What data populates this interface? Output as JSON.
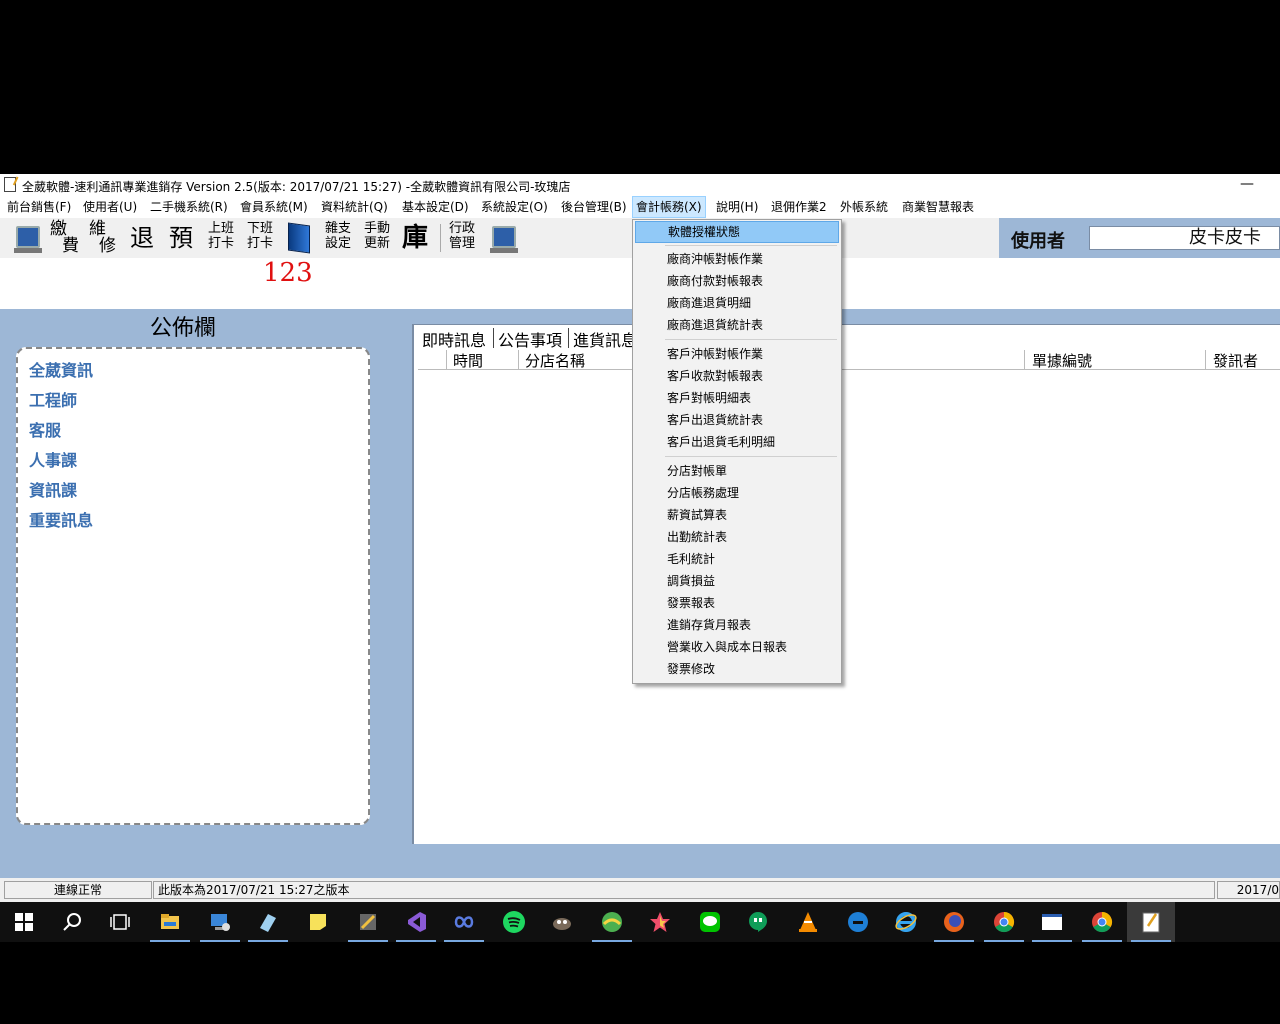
{
  "window": {
    "title": "全葳軟體-速利通訊專業進銷存 Version 2.5(版本: 2017/07/21 15:27) -全葳軟體資訊有限公司-玫瑰店",
    "minimize_glyph": "—"
  },
  "menubar": {
    "items": [
      {
        "label": "前台銷售(F)"
      },
      {
        "label": "使用者(U)"
      },
      {
        "label": "二手機系統(R)"
      },
      {
        "label": "會員系統(M)"
      },
      {
        "label": "資料統計(Q)"
      },
      {
        "label": "基本設定(D)"
      },
      {
        "label": "系統設定(O)"
      },
      {
        "label": "後台管理(B)"
      },
      {
        "label": "會計帳務(X)",
        "active": true
      },
      {
        "label": "說明(H)"
      },
      {
        "label": "退佣作業2"
      },
      {
        "label": "外帳系統"
      },
      {
        "label": "商業智慧報表"
      }
    ]
  },
  "toolbar": {
    "buttons": [
      {
        "name": "computer-icon",
        "type": "icon"
      },
      {
        "name": "pay",
        "line1": "繳",
        "line2": "費"
      },
      {
        "name": "repair",
        "line1": "維",
        "line2": "修"
      },
      {
        "name": "return",
        "text": "退"
      },
      {
        "name": "reserve",
        "text": "預"
      },
      {
        "name": "clock-in",
        "line1": "上班",
        "line2": "打卡"
      },
      {
        "name": "clock-out",
        "line1": "下班",
        "line2": "打卡"
      },
      {
        "name": "book-icon",
        "type": "icon"
      },
      {
        "name": "misc-expense",
        "line1": "雜支",
        "line2": "設定"
      },
      {
        "name": "manual-update",
        "line1": "手動",
        "line2": "更新"
      },
      {
        "name": "warehouse",
        "text": "庫"
      },
      {
        "name": "admin",
        "line1": "行政",
        "line2": "管理"
      },
      {
        "name": "computer-icon-2",
        "type": "icon"
      }
    ],
    "user_label": "使用者",
    "user_value": "皮卡皮卡",
    "counter": "123"
  },
  "bulletin": {
    "title": "公佈欄",
    "links": [
      "全葳資訊",
      "工程師",
      "客服",
      "人事課",
      "資訊課",
      "重要訊息"
    ]
  },
  "messages": {
    "tabs": [
      "即時訊息",
      "公告事項",
      "進貨訊息"
    ],
    "columns": [
      "時間",
      "分店名稱",
      "單據編號",
      "發訊者"
    ]
  },
  "dropdown": {
    "groups": [
      [
        "軟體授權狀態"
      ],
      [
        "廠商沖帳對帳作業",
        "廠商付款對帳報表",
        "廠商進退貨明細",
        "廠商進退貨統計表"
      ],
      [
        "客戶沖帳對帳作業",
        "客戶收款對帳報表",
        "客戶對帳明細表",
        "客戶出退貨統計表",
        "客戶出退貨毛利明細"
      ],
      [
        "分店對帳單",
        "分店帳務處理",
        "薪資試算表",
        "出勤統計表",
        "毛利統計",
        "調貨損益",
        "發票報表",
        "進銷存貨月報表",
        "營業收入與成本日報表",
        "發票修改"
      ]
    ],
    "highlighted": "軟體授權狀態"
  },
  "statusbar": {
    "connection": "連線正常",
    "version_note": "此版本為2017/07/21 15:27之版本",
    "date_truncated": "2017/0"
  },
  "taskbar": {
    "icons": [
      "windows-start-icon",
      "search-icon",
      "task-view-icon",
      "file-explorer-icon",
      "remote-desktop-icon",
      "eraser-app-icon",
      "sticky-notes-icon",
      "tools-app-icon",
      "visual-studio-icon",
      "infinity-app-icon",
      "spotify-icon",
      "gimp-icon",
      "maps-app-icon",
      "star-app-icon",
      "line-app-icon",
      "hangouts-icon",
      "vlc-icon",
      "edge-icon",
      "internet-explorer-icon",
      "firefox-icon",
      "chrome-icon",
      "window-app-icon",
      "chrome-icon-2",
      "notepad-app-icon"
    ],
    "colors": {
      "accent": "#78a8e0",
      "background": "#101010"
    }
  },
  "colors": {
    "panel_blue": "#9db7d6",
    "menu_highlight": "#91c9f7",
    "link_blue": "#3b6fb0",
    "counter_red": "#e01010"
  }
}
